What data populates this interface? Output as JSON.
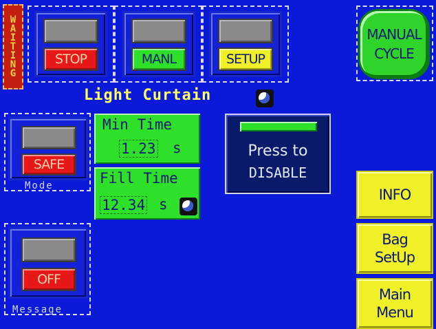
{
  "status": {
    "waiting_label": "WAITING"
  },
  "top_buttons": [
    {
      "label": "STOP",
      "color": "#e81818"
    },
    {
      "label": "MANL",
      "color": "#2ee02a"
    },
    {
      "label": "SETUP",
      "color": "#f0f028"
    }
  ],
  "manual_cycle": {
    "line1": "MANUAL",
    "line2": "CYCLE"
  },
  "light_curtain": {
    "title": "Light Curtain",
    "min_time_label": "Min Time",
    "min_time_value": "1.23",
    "min_time_unit": "s",
    "fill_time_label": "Fill Time",
    "fill_time_value": "12.34",
    "fill_time_unit": "s",
    "disable_line1": "Press to",
    "disable_line2": "DISABLE"
  },
  "mode": {
    "button_label": "SAFE",
    "caption": "Mode"
  },
  "message": {
    "button_label": "OFF",
    "caption": "Message"
  },
  "side_menu": {
    "info": "INFO",
    "bag_line1": "Bag",
    "bag_line2": "SetUp",
    "main_line1": "Main",
    "main_line2": "Menu"
  },
  "colors": {
    "background": "#0a1ad8",
    "accent_yellow": "#ffff60"
  }
}
